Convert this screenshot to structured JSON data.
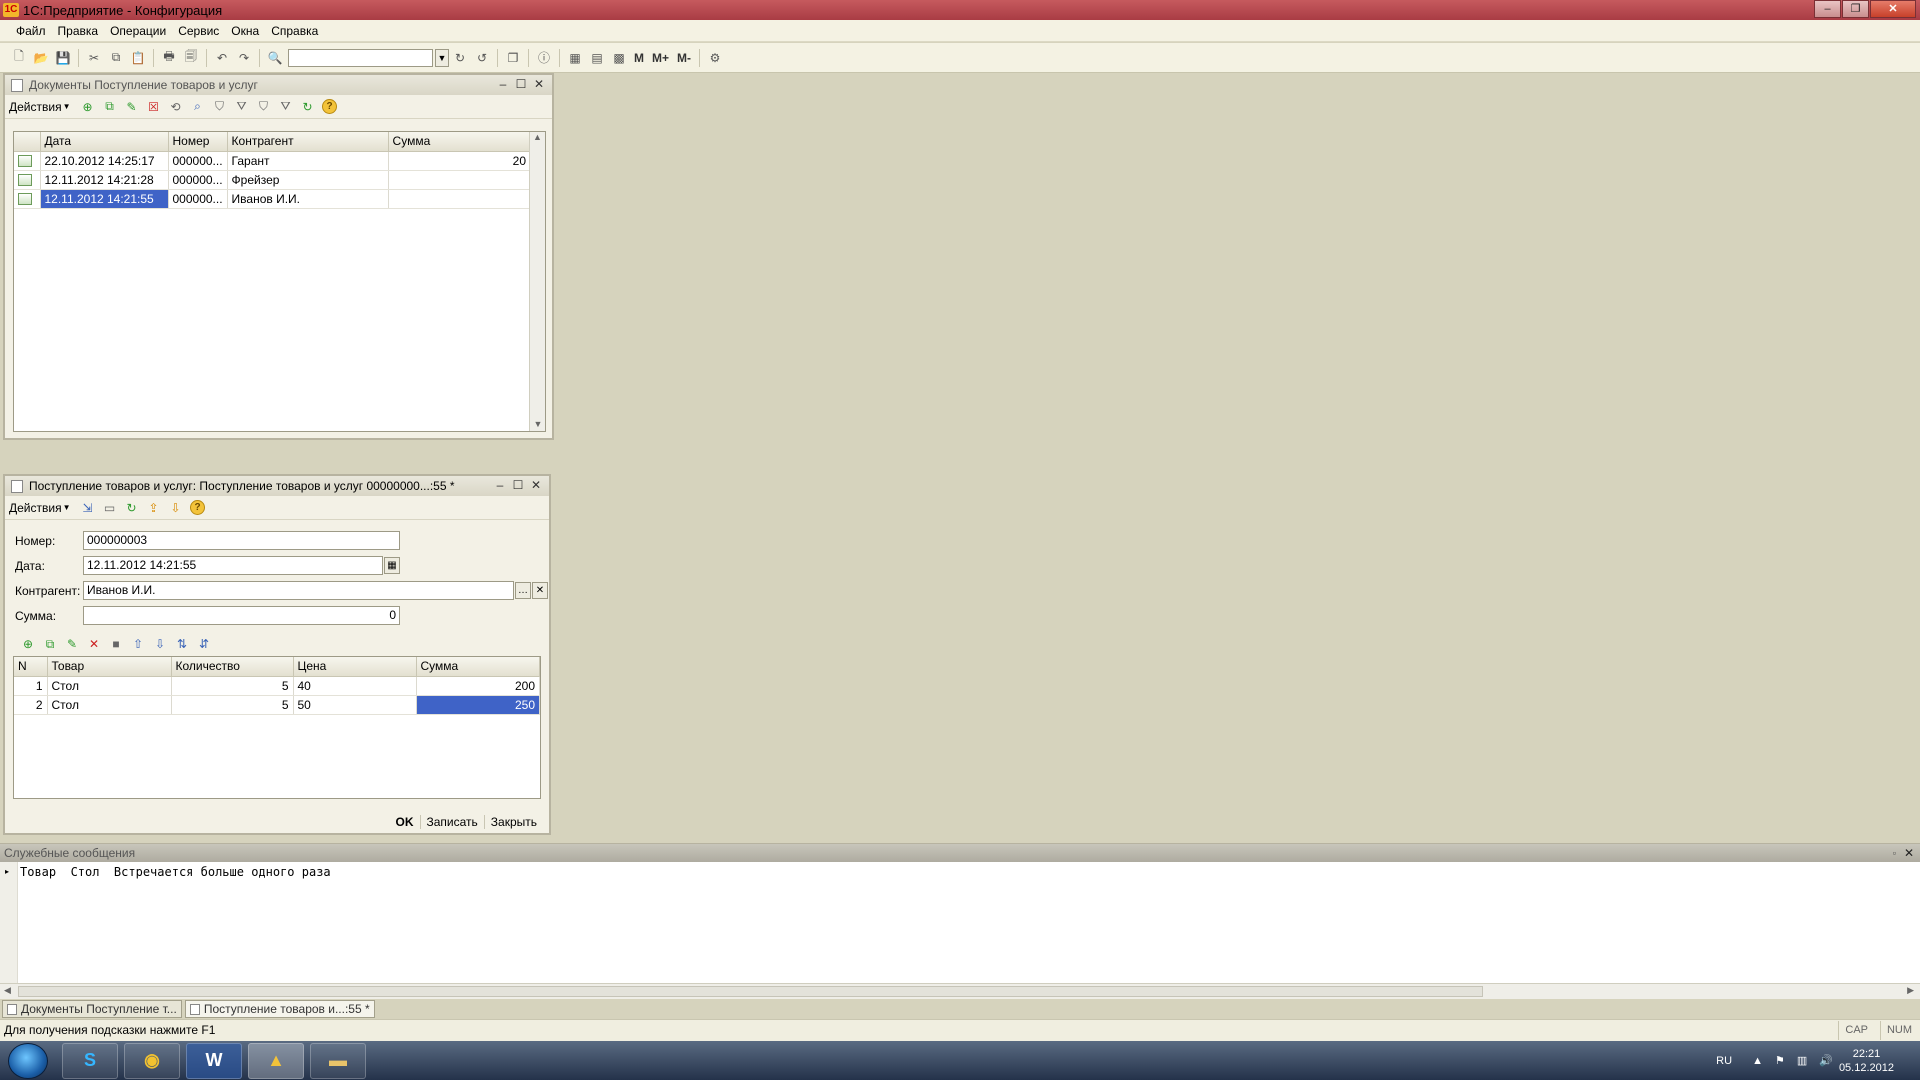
{
  "window": {
    "title": "1С:Предприятие - Конфигурация"
  },
  "menu": [
    "Файл",
    "Правка",
    "Операции",
    "Сервис",
    "Окна",
    "Справка"
  ],
  "toolbar": {
    "mem_buttons": [
      "M",
      "M+",
      "M-"
    ]
  },
  "list_window": {
    "title": "Документы Поступление товаров и услуг",
    "actions_label": "Действия",
    "columns": [
      "Дата",
      "Номер",
      "Контрагент",
      "Сумма"
    ],
    "rows": [
      {
        "date": "22.10.2012 14:25:17",
        "number": "000000...",
        "contractor": "Гарант",
        "sum": "20"
      },
      {
        "date": "12.11.2012 14:21:28",
        "number": "000000...",
        "contractor": "Фрейзер",
        "sum": ""
      },
      {
        "date": "12.11.2012 14:21:55",
        "number": "000000...",
        "contractor": "Иванов И.И.",
        "sum": ""
      }
    ]
  },
  "doc_window": {
    "title": "Поступление товаров и услуг: Поступление товаров и услуг 00000000...:55 *",
    "actions_label": "Действия",
    "fields": {
      "number_label": "Номер:",
      "number_value": "000000003",
      "date_label": "Дата:",
      "date_value": "12.11.2012 14:21:55",
      "contractor_label": "Контрагент:",
      "contractor_value": "Иванов И.И.",
      "sum_label": "Сумма:",
      "sum_value": "0"
    },
    "columns": [
      "N",
      "Товар",
      "Количество",
      "Цена",
      "Сумма"
    ],
    "rows": [
      {
        "n": "1",
        "item": "Стол",
        "qty": "5",
        "price": "40",
        "sum": "200"
      },
      {
        "n": "2",
        "item": "Стол",
        "qty": "5",
        "price": "50",
        "sum": "250"
      }
    ],
    "buttons": {
      "ok": "OK",
      "save": "Записать",
      "close": "Закрыть"
    }
  },
  "messages": {
    "title": "Служебные сообщения",
    "lines": [
      "Товар  Стол  Встречается больше одного раза"
    ]
  },
  "window_tabs": [
    "Документы Поступление т...",
    "Поступление товаров и...:55 *"
  ],
  "status": {
    "hint": "Для получения подсказки нажмите F1",
    "cap": "CAP",
    "num": "NUM"
  },
  "tray": {
    "lang": "RU",
    "time": "22:21",
    "date": "05.12.2012"
  },
  "colors": {
    "titlebar": "#b5474d",
    "selection": "#3f63c7",
    "workspace": "#d6d3bd"
  }
}
